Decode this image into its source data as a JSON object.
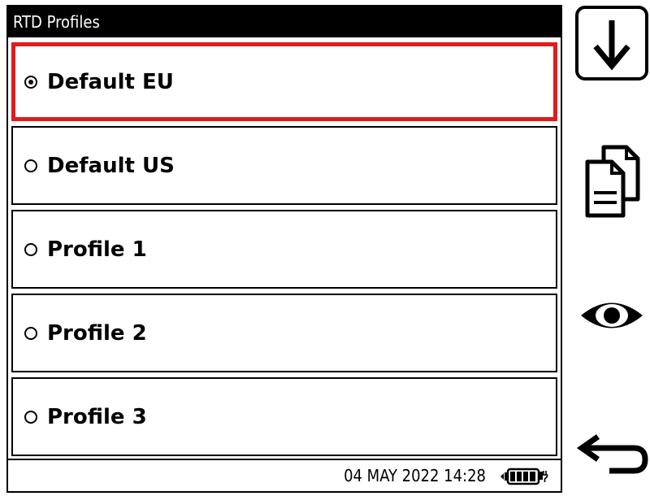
{
  "title": "RTD Profiles",
  "profiles": [
    {
      "label": "Default EU",
      "selected": true
    },
    {
      "label": "Default US",
      "selected": false
    },
    {
      "label": "Profile 1",
      "selected": false
    },
    {
      "label": "Profile 2",
      "selected": false
    },
    {
      "label": "Profile 3",
      "selected": false
    }
  ],
  "status": {
    "datetime": "04 MAY 2022 14:28",
    "battery_icon": "battery-full-charging-icon"
  },
  "side_buttons": [
    {
      "icon": "download-arrow-icon"
    },
    {
      "icon": "copy-documents-icon"
    },
    {
      "icon": "eye-icon"
    },
    {
      "icon": "back-return-icon"
    }
  ],
  "colors": {
    "selection_border": "#e21b1b",
    "titlebar_bg": "#000000"
  }
}
